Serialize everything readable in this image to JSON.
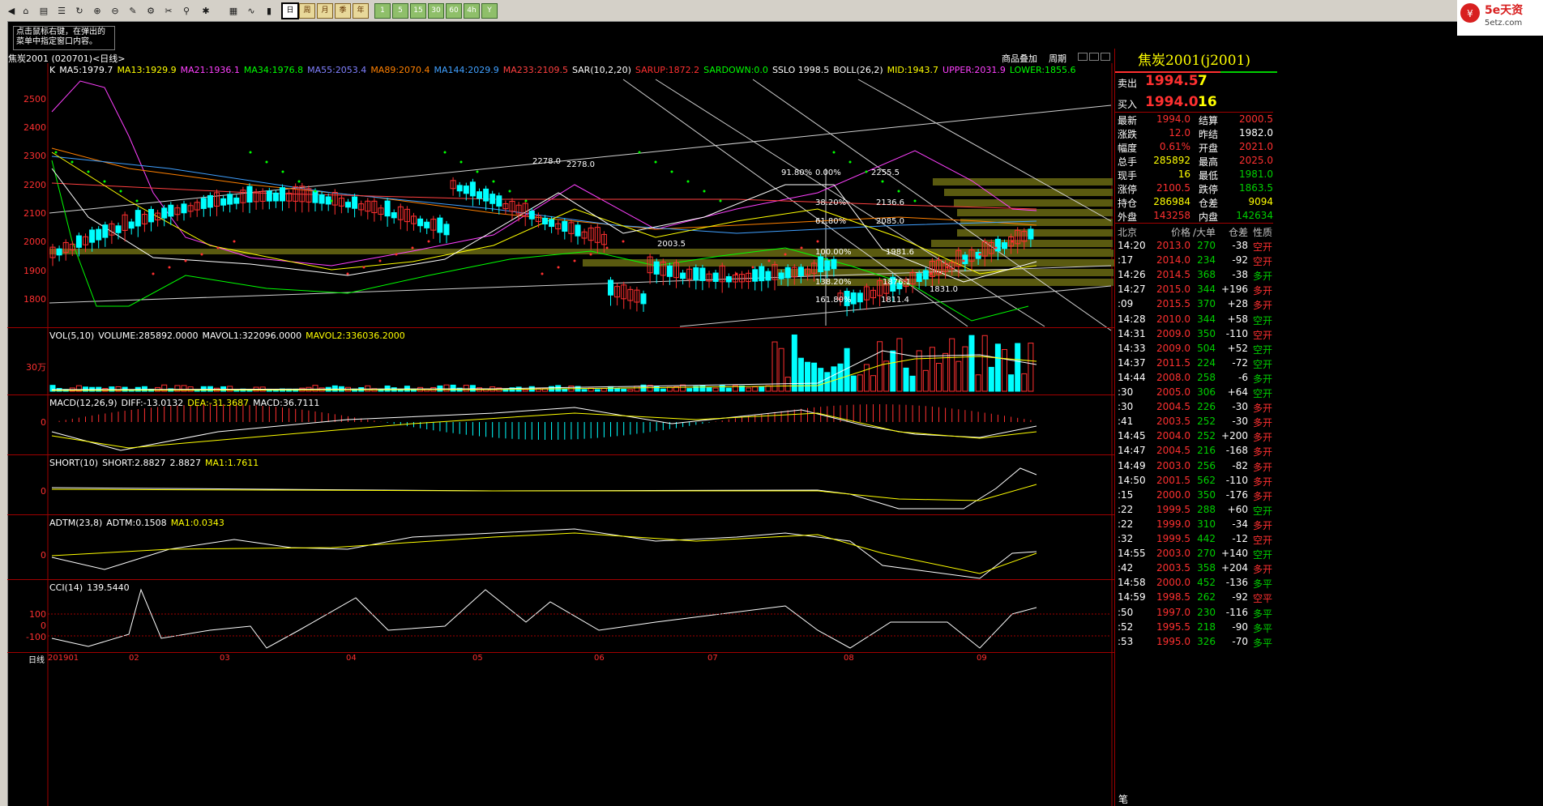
{
  "toolbar": {
    "periods": [
      "日",
      "周",
      "月",
      "季",
      "年",
      "1",
      "5",
      "15",
      "30",
      "60",
      "4h",
      "Y"
    ],
    "active_period": "日"
  },
  "hint": "点击鼠标右键，在弹出的菜单中指定窗口内容。",
  "logo_text": "5e天资 5etz.com",
  "chart": {
    "title": "焦炭2001 (020701)<日线>",
    "link_overlay": "商品叠加",
    "link_period": "周期",
    "main_indicators": [
      {
        "text": "K",
        "color": "#ffffff"
      },
      {
        "text": "MA5:1979.7",
        "color": "#ffffff"
      },
      {
        "text": "MA13:1929.9",
        "color": "#ffff00"
      },
      {
        "text": "MA21:1936.1",
        "color": "#ff40ff"
      },
      {
        "text": "MA34:1976.8",
        "color": "#00ff00"
      },
      {
        "text": "MA55:2053.4",
        "color": "#8080ff"
      },
      {
        "text": "MA89:2070.4",
        "color": "#ff8000"
      },
      {
        "text": "MA144:2029.9",
        "color": "#40a0ff"
      },
      {
        "text": "MA233:2109.5",
        "color": "#ff4040"
      },
      {
        "text": "SAR(10,2,20)",
        "color": "#ffffff"
      },
      {
        "text": "SARUP:1872.2",
        "color": "#ff3030"
      },
      {
        "text": "SARDOWN:0.0",
        "color": "#00ff00"
      },
      {
        "text": "SSLO 1998.5",
        "color": "#ffffff"
      },
      {
        "text": "BOLL(26,2)",
        "color": "#ffffff"
      },
      {
        "text": "MID:1943.7",
        "color": "#ffff00"
      },
      {
        "text": "UPPER:2031.9",
        "color": "#ff40ff"
      },
      {
        "text": "LOWER:1855.6",
        "color": "#00ff00"
      }
    ],
    "y_labels": [
      "2500",
      "2400",
      "2300",
      "2200",
      "2100",
      "2000",
      "1900",
      "1800"
    ],
    "fib_labels": [
      {
        "text": "91.80%",
        "color": "#ffffff"
      },
      {
        "text": "0.00%",
        "color": "#ffffff"
      },
      {
        "text": "2255.5",
        "color": "#ffffff"
      },
      {
        "text": "38.20%",
        "color": "#ffffff"
      },
      {
        "text": "2136.6",
        "color": "#ffffff"
      },
      {
        "text": "61.80%",
        "color": "#ffffff"
      },
      {
        "text": "2085.0",
        "color": "#ffffff"
      },
      {
        "text": "100.00%",
        "color": "#ffffff"
      },
      {
        "text": "1981.6",
        "color": "#ffffff"
      },
      {
        "text": "138.20%",
        "color": "#ffffff"
      },
      {
        "text": "1876.1",
        "color": "#ffffff"
      },
      {
        "text": "161.80%",
        "color": "#ffffff"
      },
      {
        "text": "1811.4",
        "color": "#ffffff"
      }
    ],
    "price_marks": {
      "high": "2278.0",
      "high2": "2278.0",
      "mid": "2003.5",
      "low": "1831.0"
    },
    "vol_indicators": [
      {
        "text": "VOL(5,10)",
        "color": "#ffffff"
      },
      {
        "text": "VOLUME:285892.0000",
        "color": "#ffffff"
      },
      {
        "text": "MAVOL1:322096.0000",
        "color": "#ffffff"
      },
      {
        "text": "MAVOL2:336036.2000",
        "color": "#ffff00"
      }
    ],
    "vol_y": "30万",
    "macd_indicators": [
      {
        "text": "MACD(12,26,9)",
        "color": "#ffffff"
      },
      {
        "text": "DIFF:-13.0132",
        "color": "#ffffff"
      },
      {
        "text": "DEA:-31.3687",
        "color": "#ffff00"
      },
      {
        "text": "MACD:36.7111",
        "color": "#ffffff"
      }
    ],
    "short_indicators": [
      {
        "text": "SHORT(10)",
        "color": "#ffffff"
      },
      {
        "text": "SHORT:2.8827",
        "color": "#ffffff"
      },
      {
        "text": "2.8827",
        "color": "#ffffff"
      },
      {
        "text": "MA1:1.7611",
        "color": "#ffff00"
      }
    ],
    "adtm_indicators": [
      {
        "text": "ADTM(23,8)",
        "color": "#ffffff"
      },
      {
        "text": "ADTM:0.1508",
        "color": "#ffffff"
      },
      {
        "text": "MA1:0.0343",
        "color": "#ffff00"
      }
    ],
    "cci_indicators": [
      {
        "text": "CCI(14)",
        "color": "#ffffff"
      },
      {
        "text": "139.5440",
        "color": "#ffffff"
      }
    ],
    "zero": "0",
    "cci_y": [
      "100",
      "0",
      "-100"
    ],
    "x_prefix": "日线",
    "x_labels": [
      "201901",
      "02",
      "03",
      "04",
      "05",
      "06",
      "07",
      "08",
      "09"
    ]
  },
  "quote": {
    "title": "焦炭2001(j2001)",
    "sell_label": "卖出",
    "sell_price": "1994.5",
    "sell_vol": "7",
    "buy_label": "买入",
    "buy_price": "1994.0",
    "buy_vol": "16",
    "rows": [
      {
        "l1": "最新",
        "v1": "1994.0",
        "c1": "#ff3030",
        "l2": "结算",
        "v2": "2000.5",
        "c2": "#ff3030"
      },
      {
        "l1": "涨跌",
        "v1": "12.0",
        "c1": "#ff3030",
        "l2": "昨结",
        "v2": "1982.0",
        "c2": "#ffffff"
      },
      {
        "l1": "幅度",
        "v1": "0.61%",
        "c1": "#ff3030",
        "l2": "开盘",
        "v2": "2021.0",
        "c2": "#ff3030"
      },
      {
        "l1": "总手",
        "v1": "285892",
        "c1": "#ffff00",
        "l2": "最高",
        "v2": "2025.0",
        "c2": "#ff3030"
      },
      {
        "l1": "现手",
        "v1": "16",
        "c1": "#ffff00",
        "l2": "最低",
        "v2": "1981.0",
        "c2": "#00d000"
      },
      {
        "l1": "涨停",
        "v1": "2100.5",
        "c1": "#ff3030",
        "l2": "跌停",
        "v2": "1863.5",
        "c2": "#00d000"
      },
      {
        "l1": "持仓",
        "v1": "286984",
        "c1": "#ffff00",
        "l2": "仓差",
        "v2": "9094",
        "c2": "#ffff00"
      },
      {
        "l1": "外盘",
        "v1": "143258",
        "c1": "#ff3030",
        "l2": "内盘",
        "v2": "142634",
        "c2": "#00d000"
      }
    ],
    "tick_header": [
      "北京",
      "价格",
      "/大单",
      "仓差",
      "性质"
    ],
    "ticks": [
      {
        "t": "14:20",
        "p": "2013.0",
        "v": "270",
        "d": "-38",
        "n": "空开",
        "pc": "#ff3030",
        "nc": "#ff3030"
      },
      {
        "t": ":17",
        "p": "2014.0",
        "v": "234",
        "d": "-92",
        "n": "空开",
        "pc": "#ff3030",
        "nc": "#ff3030"
      },
      {
        "t": "14:26",
        "p": "2014.5",
        "v": "368",
        "d": "-38",
        "n": "多开",
        "pc": "#ff3030",
        "nc": "#00d000"
      },
      {
        "t": "14:27",
        "p": "2015.0",
        "v": "344",
        "d": "+196",
        "n": "多开",
        "pc": "#ff3030",
        "nc": "#ff3030"
      },
      {
        "t": ":09",
        "p": "2015.5",
        "v": "370",
        "d": "+28",
        "n": "多开",
        "pc": "#ff3030",
        "nc": "#ff3030"
      },
      {
        "t": "14:28",
        "p": "2010.0",
        "v": "344",
        "d": "+58",
        "n": "空开",
        "pc": "#ff3030",
        "nc": "#00d000"
      },
      {
        "t": "14:31",
        "p": "2009.0",
        "v": "350",
        "d": "-110",
        "n": "空开",
        "pc": "#ff3030",
        "nc": "#ff3030"
      },
      {
        "t": "14:33",
        "p": "2009.0",
        "v": "504",
        "d": "+52",
        "n": "空开",
        "pc": "#ff3030",
        "nc": "#00d000"
      },
      {
        "t": "14:37",
        "p": "2011.5",
        "v": "224",
        "d": "-72",
        "n": "空开",
        "pc": "#ff3030",
        "nc": "#00d000"
      },
      {
        "t": "14:44",
        "p": "2008.0",
        "v": "258",
        "d": "-6",
        "n": "多开",
        "pc": "#ff3030",
        "nc": "#00d000"
      },
      {
        "t": ":30",
        "p": "2005.0",
        "v": "306",
        "d": "+64",
        "n": "空开",
        "pc": "#ff3030",
        "nc": "#00d000"
      },
      {
        "t": ":30",
        "p": "2004.5",
        "v": "226",
        "d": "-30",
        "n": "多开",
        "pc": "#ff3030",
        "nc": "#ff3030"
      },
      {
        "t": ":41",
        "p": "2003.5",
        "v": "252",
        "d": "-30",
        "n": "多开",
        "pc": "#ff3030",
        "nc": "#ff3030"
      },
      {
        "t": "14:45",
        "p": "2004.0",
        "v": "252",
        "d": "+200",
        "n": "多开",
        "pc": "#ff3030",
        "nc": "#ff3030"
      },
      {
        "t": "14:47",
        "p": "2004.5",
        "v": "216",
        "d": "-168",
        "n": "多开",
        "pc": "#ff3030",
        "nc": "#ff3030"
      },
      {
        "t": "14:49",
        "p": "2003.0",
        "v": "256",
        "d": "-82",
        "n": "多开",
        "pc": "#ff3030",
        "nc": "#ff3030"
      },
      {
        "t": "14:50",
        "p": "2001.5",
        "v": "562",
        "d": "-110",
        "n": "多开",
        "pc": "#ff3030",
        "nc": "#ff3030"
      },
      {
        "t": ":15",
        "p": "2000.0",
        "v": "350",
        "d": "-176",
        "n": "多开",
        "pc": "#ff3030",
        "nc": "#ff3030"
      },
      {
        "t": ":22",
        "p": "1999.5",
        "v": "288",
        "d": "+60",
        "n": "空开",
        "pc": "#ff3030",
        "nc": "#00d000"
      },
      {
        "t": ":22",
        "p": "1999.0",
        "v": "310",
        "d": "-34",
        "n": "多开",
        "pc": "#ff3030",
        "nc": "#ff3030"
      },
      {
        "t": ":32",
        "p": "1999.5",
        "v": "442",
        "d": "-12",
        "n": "空开",
        "pc": "#ff3030",
        "nc": "#ff3030"
      },
      {
        "t": "14:55",
        "p": "2003.0",
        "v": "270",
        "d": "+140",
        "n": "空开",
        "pc": "#ff3030",
        "nc": "#00d000"
      },
      {
        "t": ":42",
        "p": "2003.5",
        "v": "358",
        "d": "+204",
        "n": "多开",
        "pc": "#ff3030",
        "nc": "#ff3030"
      },
      {
        "t": "14:58",
        "p": "2000.0",
        "v": "452",
        "d": "-136",
        "n": "多平",
        "pc": "#ff3030",
        "nc": "#00d000"
      },
      {
        "t": "14:59",
        "p": "1998.5",
        "v": "262",
        "d": "-92",
        "n": "空平",
        "pc": "#ff3030",
        "nc": "#ff3030"
      },
      {
        "t": ":50",
        "p": "1997.0",
        "v": "230",
        "d": "-116",
        "n": "多平",
        "pc": "#ff3030",
        "nc": "#00d000"
      },
      {
        "t": ":52",
        "p": "1995.5",
        "v": "218",
        "d": "-90",
        "n": "多平",
        "pc": "#ff3030",
        "nc": "#00d000"
      },
      {
        "t": ":53",
        "p": "1995.0",
        "v": "326",
        "d": "-70",
        "n": "多平",
        "pc": "#ff3030",
        "nc": "#00d000"
      }
    ],
    "bottom_tab": "笔"
  }
}
